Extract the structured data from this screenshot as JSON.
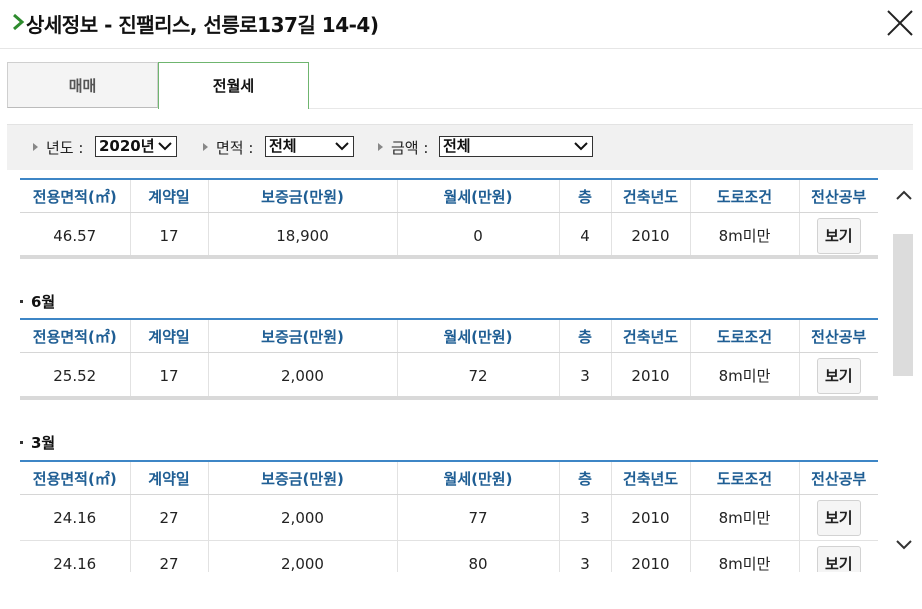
{
  "title": "상세정보 - 진팰리스, 선릉로137길 14-4)",
  "tabs": {
    "sale": "매매",
    "rent": "전월세"
  },
  "filters": {
    "year_label": "년도 :",
    "year_value": "2020년",
    "area_label": "면적 :",
    "area_value": "전체",
    "price_label": "금액 :",
    "price_value": "전체"
  },
  "columns": [
    "전용면적(㎡)",
    "계약일",
    "보증금(만원)",
    "월세(만원)",
    "층",
    "건축년도",
    "도로조건",
    "전산공부"
  ],
  "groups": [
    {
      "month": "",
      "rows": [
        {
          "area": "46.57",
          "day": "17",
          "deposit": "18,900",
          "rent": "0",
          "floor": "4",
          "year": "2010",
          "road": "8m미만",
          "doc": "보기"
        }
      ]
    },
    {
      "month": "6월",
      "rows": [
        {
          "area": "25.52",
          "day": "17",
          "deposit": "2,000",
          "rent": "72",
          "floor": "3",
          "year": "2010",
          "road": "8m미만",
          "doc": "보기"
        }
      ]
    },
    {
      "month": "3월",
      "rows": [
        {
          "area": "24.16",
          "day": "27",
          "deposit": "2,000",
          "rent": "77",
          "floor": "3",
          "year": "2010",
          "road": "8m미만",
          "doc": "보기"
        },
        {
          "area": "24.16",
          "day": "27",
          "deposit": "2,000",
          "rent": "80",
          "floor": "3",
          "year": "2010",
          "road": "8m미만",
          "doc": "보기"
        }
      ]
    }
  ],
  "icons": {
    "title_arrow": "chevron-right-icon",
    "close": "close-icon",
    "select": "chevron-down-icon",
    "scroll_up": "chevron-up-icon",
    "scroll_down": "chevron-down-icon"
  },
  "colors": {
    "accent_green": "#2e8b2e",
    "header_blue": "#1f5e94",
    "table_top_border": "#3d86c6",
    "tab_active_border": "#6fb56f"
  }
}
